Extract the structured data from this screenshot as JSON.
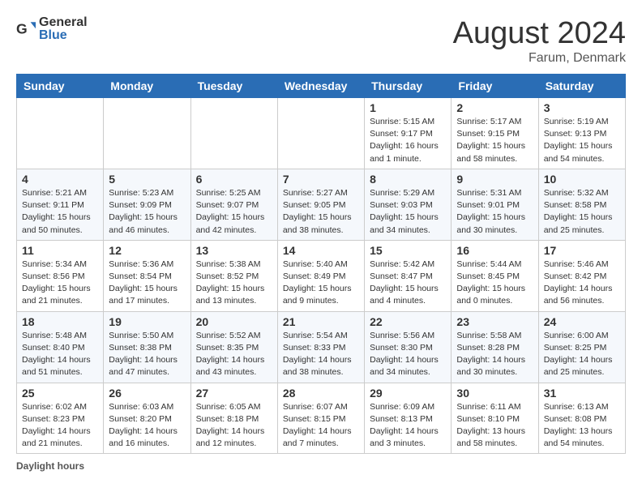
{
  "header": {
    "logo_general": "General",
    "logo_blue": "Blue",
    "month_title": "August 2024",
    "location": "Farum, Denmark"
  },
  "calendar": {
    "columns": [
      "Sunday",
      "Monday",
      "Tuesday",
      "Wednesday",
      "Thursday",
      "Friday",
      "Saturday"
    ],
    "weeks": [
      [
        {
          "day": "",
          "info": ""
        },
        {
          "day": "",
          "info": ""
        },
        {
          "day": "",
          "info": ""
        },
        {
          "day": "",
          "info": ""
        },
        {
          "day": "1",
          "info": "Sunrise: 5:15 AM\nSunset: 9:17 PM\nDaylight: 16 hours and 1 minute."
        },
        {
          "day": "2",
          "info": "Sunrise: 5:17 AM\nSunset: 9:15 PM\nDaylight: 15 hours and 58 minutes."
        },
        {
          "day": "3",
          "info": "Sunrise: 5:19 AM\nSunset: 9:13 PM\nDaylight: 15 hours and 54 minutes."
        }
      ],
      [
        {
          "day": "4",
          "info": "Sunrise: 5:21 AM\nSunset: 9:11 PM\nDaylight: 15 hours and 50 minutes."
        },
        {
          "day": "5",
          "info": "Sunrise: 5:23 AM\nSunset: 9:09 PM\nDaylight: 15 hours and 46 minutes."
        },
        {
          "day": "6",
          "info": "Sunrise: 5:25 AM\nSunset: 9:07 PM\nDaylight: 15 hours and 42 minutes."
        },
        {
          "day": "7",
          "info": "Sunrise: 5:27 AM\nSunset: 9:05 PM\nDaylight: 15 hours and 38 minutes."
        },
        {
          "day": "8",
          "info": "Sunrise: 5:29 AM\nSunset: 9:03 PM\nDaylight: 15 hours and 34 minutes."
        },
        {
          "day": "9",
          "info": "Sunrise: 5:31 AM\nSunset: 9:01 PM\nDaylight: 15 hours and 30 minutes."
        },
        {
          "day": "10",
          "info": "Sunrise: 5:32 AM\nSunset: 8:58 PM\nDaylight: 15 hours and 25 minutes."
        }
      ],
      [
        {
          "day": "11",
          "info": "Sunrise: 5:34 AM\nSunset: 8:56 PM\nDaylight: 15 hours and 21 minutes."
        },
        {
          "day": "12",
          "info": "Sunrise: 5:36 AM\nSunset: 8:54 PM\nDaylight: 15 hours and 17 minutes."
        },
        {
          "day": "13",
          "info": "Sunrise: 5:38 AM\nSunset: 8:52 PM\nDaylight: 15 hours and 13 minutes."
        },
        {
          "day": "14",
          "info": "Sunrise: 5:40 AM\nSunset: 8:49 PM\nDaylight: 15 hours and 9 minutes."
        },
        {
          "day": "15",
          "info": "Sunrise: 5:42 AM\nSunset: 8:47 PM\nDaylight: 15 hours and 4 minutes."
        },
        {
          "day": "16",
          "info": "Sunrise: 5:44 AM\nSunset: 8:45 PM\nDaylight: 15 hours and 0 minutes."
        },
        {
          "day": "17",
          "info": "Sunrise: 5:46 AM\nSunset: 8:42 PM\nDaylight: 14 hours and 56 minutes."
        }
      ],
      [
        {
          "day": "18",
          "info": "Sunrise: 5:48 AM\nSunset: 8:40 PM\nDaylight: 14 hours and 51 minutes."
        },
        {
          "day": "19",
          "info": "Sunrise: 5:50 AM\nSunset: 8:38 PM\nDaylight: 14 hours and 47 minutes."
        },
        {
          "day": "20",
          "info": "Sunrise: 5:52 AM\nSunset: 8:35 PM\nDaylight: 14 hours and 43 minutes."
        },
        {
          "day": "21",
          "info": "Sunrise: 5:54 AM\nSunset: 8:33 PM\nDaylight: 14 hours and 38 minutes."
        },
        {
          "day": "22",
          "info": "Sunrise: 5:56 AM\nSunset: 8:30 PM\nDaylight: 14 hours and 34 minutes."
        },
        {
          "day": "23",
          "info": "Sunrise: 5:58 AM\nSunset: 8:28 PM\nDaylight: 14 hours and 30 minutes."
        },
        {
          "day": "24",
          "info": "Sunrise: 6:00 AM\nSunset: 8:25 PM\nDaylight: 14 hours and 25 minutes."
        }
      ],
      [
        {
          "day": "25",
          "info": "Sunrise: 6:02 AM\nSunset: 8:23 PM\nDaylight: 14 hours and 21 minutes."
        },
        {
          "day": "26",
          "info": "Sunrise: 6:03 AM\nSunset: 8:20 PM\nDaylight: 14 hours and 16 minutes."
        },
        {
          "day": "27",
          "info": "Sunrise: 6:05 AM\nSunset: 8:18 PM\nDaylight: 14 hours and 12 minutes."
        },
        {
          "day": "28",
          "info": "Sunrise: 6:07 AM\nSunset: 8:15 PM\nDaylight: 14 hours and 7 minutes."
        },
        {
          "day": "29",
          "info": "Sunrise: 6:09 AM\nSunset: 8:13 PM\nDaylight: 14 hours and 3 minutes."
        },
        {
          "day": "30",
          "info": "Sunrise: 6:11 AM\nSunset: 8:10 PM\nDaylight: 13 hours and 58 minutes."
        },
        {
          "day": "31",
          "info": "Sunrise: 6:13 AM\nSunset: 8:08 PM\nDaylight: 13 hours and 54 minutes."
        }
      ]
    ]
  },
  "footer": {
    "label": "Daylight hours"
  }
}
